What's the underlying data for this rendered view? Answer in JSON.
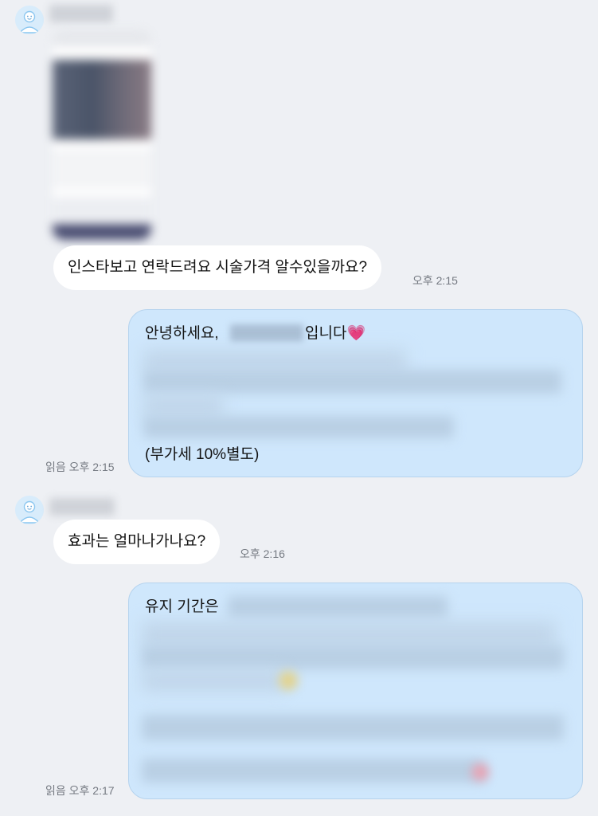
{
  "messages": [
    {
      "id": "m1",
      "direction": "incoming",
      "text": "인스타보고 연락드려요 시술가격 알수있을까요?",
      "time": "오후 2:15"
    },
    {
      "id": "m2",
      "direction": "outgoing",
      "line1_prefix": "안녕하세요,",
      "line1_suffix": "입니다",
      "emoji": "💗",
      "last_line": "(부가세 10%별도)",
      "read": "읽음",
      "time": "오후 2:15"
    },
    {
      "id": "m3",
      "direction": "incoming",
      "text": "효과는 얼마나가나요?",
      "time": "오후 2:16"
    },
    {
      "id": "m4",
      "direction": "outgoing",
      "line1_prefix": "유지 기간은",
      "read": "읽음",
      "time": "오후 2:17"
    }
  ],
  "colors": {
    "background": "#eef0f4",
    "incoming_bubble": "#ffffff",
    "outgoing_bubble": "#cfe7fc",
    "outgoing_border": "#b5d3ee",
    "meta_text": "#757a82",
    "avatar_bg": "#d8ecfb"
  },
  "icons": {
    "avatar": "default-user-avatar-icon",
    "heart": "pink-heart-emoji"
  }
}
